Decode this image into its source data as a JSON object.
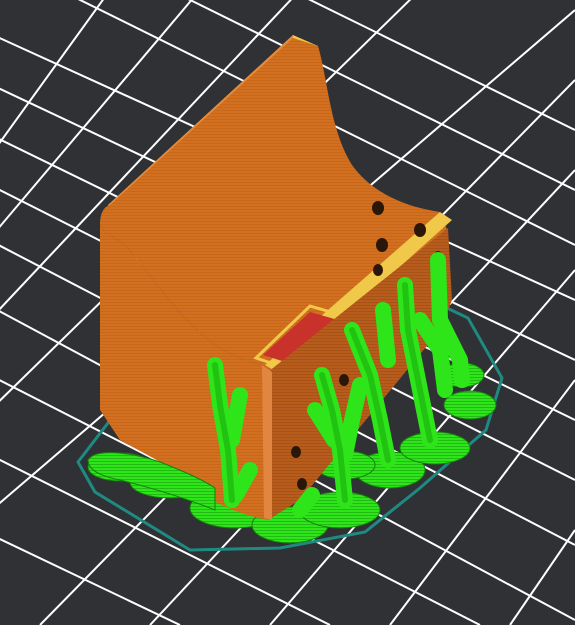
{
  "scene": {
    "colors": {
      "background": "#2f3135",
      "grid_line": "#ffffff",
      "grid_line_minor": "#5a5d62",
      "model_orange": "#d3701f",
      "model_orange_dark": "#a8531a",
      "model_orange_light": "#e0843a",
      "perimeter_yellow": "#f0c84a",
      "solid_infill_red": "#c8322a",
      "support_green": "#2ee51a",
      "support_green_dark": "#1a9e10",
      "skirt_teal": "#1f8a82"
    },
    "objects": {
      "bed_grid": "bed-grid",
      "model": "sliced-model",
      "supports": "tree-supports",
      "skirt": "skirt-outline"
    }
  }
}
